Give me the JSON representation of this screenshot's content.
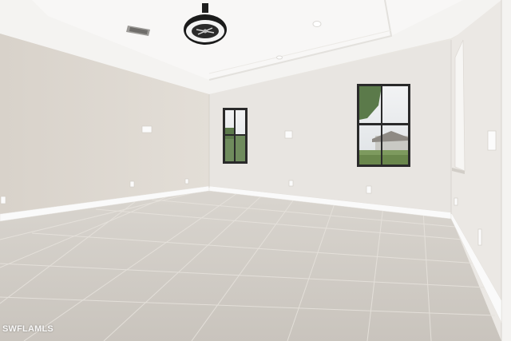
{
  "watermark": {
    "text": "SWFLAMLS"
  },
  "colors": {
    "ceiling": "#f5f4f2",
    "left_wall": "#dfdad3",
    "back_wall": "#e9e6e2",
    "right_wall": "#ece9e5",
    "floor": "#cfcac4",
    "baseboard": "#fbfbfa",
    "window_frame": "#2a2a2a"
  },
  "icons": {
    "ceiling_fan": "ceiling-fan-icon",
    "air_vent": "air-vent-icon"
  }
}
